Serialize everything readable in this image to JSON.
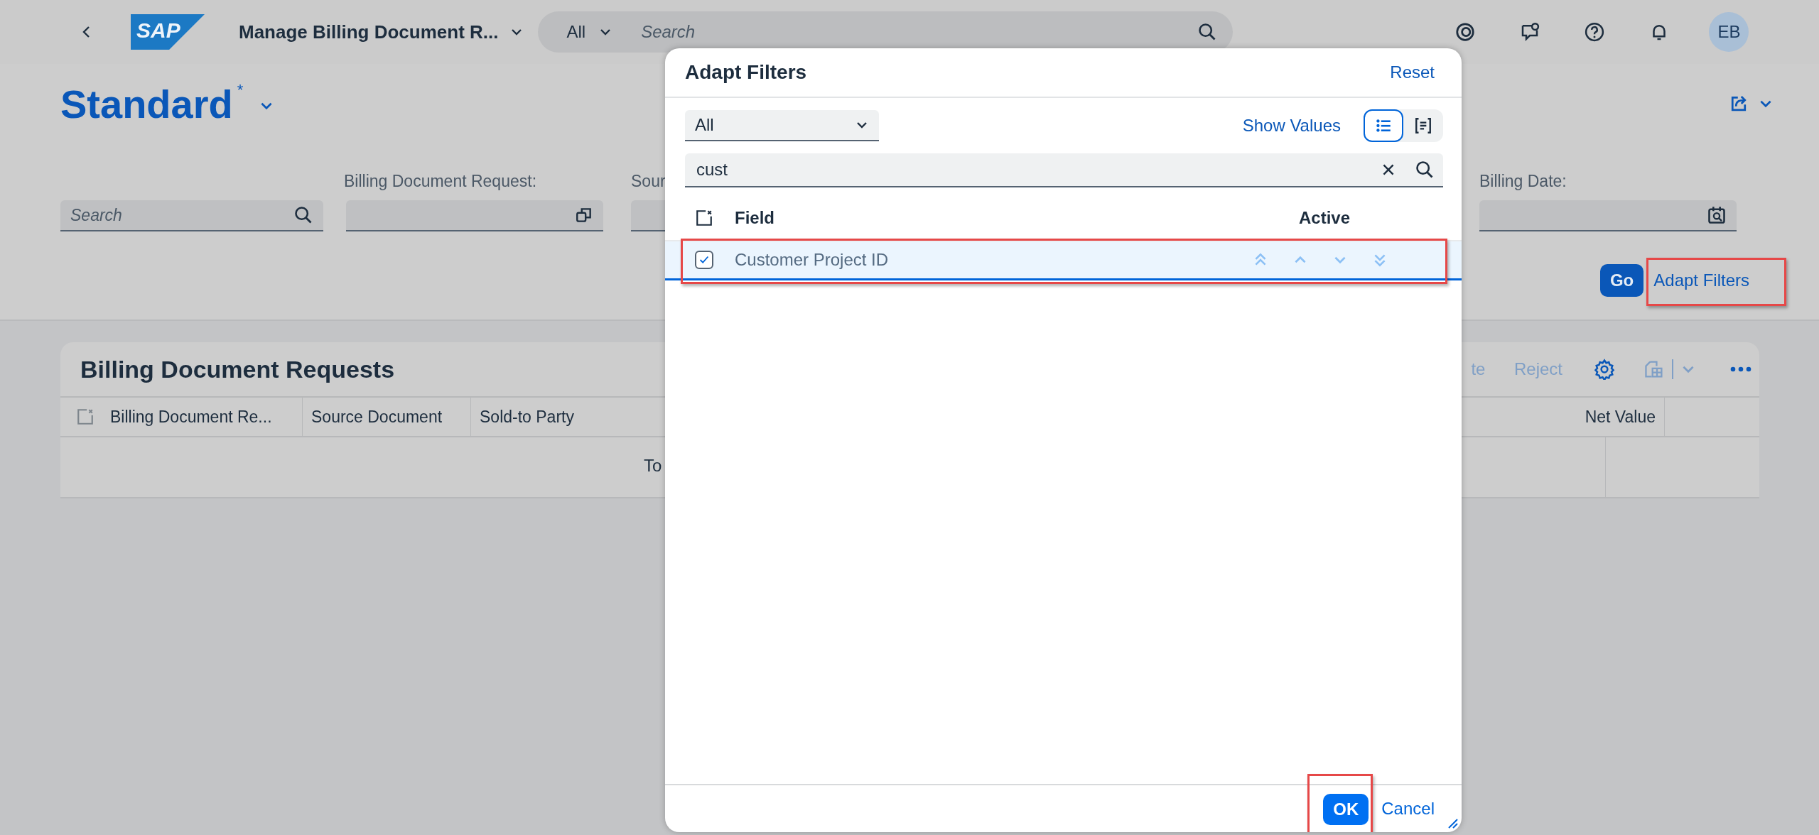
{
  "shell": {
    "logo": "SAP",
    "title": "Manage Billing Document R...",
    "search": {
      "scope": "All",
      "placeholder": "Search"
    },
    "avatar": "EB"
  },
  "variant": {
    "name": "Standard",
    "modified_mark": "*"
  },
  "filter_bar": {
    "search": {
      "placeholder": "Search"
    },
    "fields": [
      {
        "label": "Billing Document Request:",
        "kind": "value_help"
      },
      {
        "label": "Sour",
        "kind": "cut"
      },
      {
        "label": "Billing Date:",
        "kind": "date"
      }
    ],
    "go": "Go",
    "adapt_filters": {
      "label": "Adapt Filters",
      "highlighted": true
    }
  },
  "table": {
    "title": "Billing Document Requests",
    "actions": [
      {
        "label": "te",
        "disabled": true,
        "kind": "cut"
      },
      {
        "label": "Reject",
        "disabled": true,
        "kind": "text"
      }
    ],
    "columns": [
      {
        "label": "Billing Document Re...",
        "kind": "text"
      },
      {
        "label": "Source Document",
        "kind": "text"
      },
      {
        "label": "Sold-to Party",
        "kind": "text"
      },
      {
        "label": "Net Value",
        "kind": "amount"
      }
    ],
    "no_data": "To"
  },
  "dialog": {
    "title": "Adapt Filters",
    "reset": "Reset",
    "group_select": {
      "value": "All"
    },
    "show_values": "Show Values",
    "view_modes": [
      {
        "kind": "list",
        "selected": true
      },
      {
        "kind": "text",
        "selected": false
      }
    ],
    "search": {
      "value": "cust"
    },
    "columns": [
      "Field",
      "Active"
    ],
    "rows": [
      {
        "field": "Customer Project ID",
        "checked": true,
        "selected": true,
        "highlighted": true
      }
    ],
    "ok": {
      "label": "OK",
      "highlighted": true
    },
    "cancel": "Cancel"
  }
}
